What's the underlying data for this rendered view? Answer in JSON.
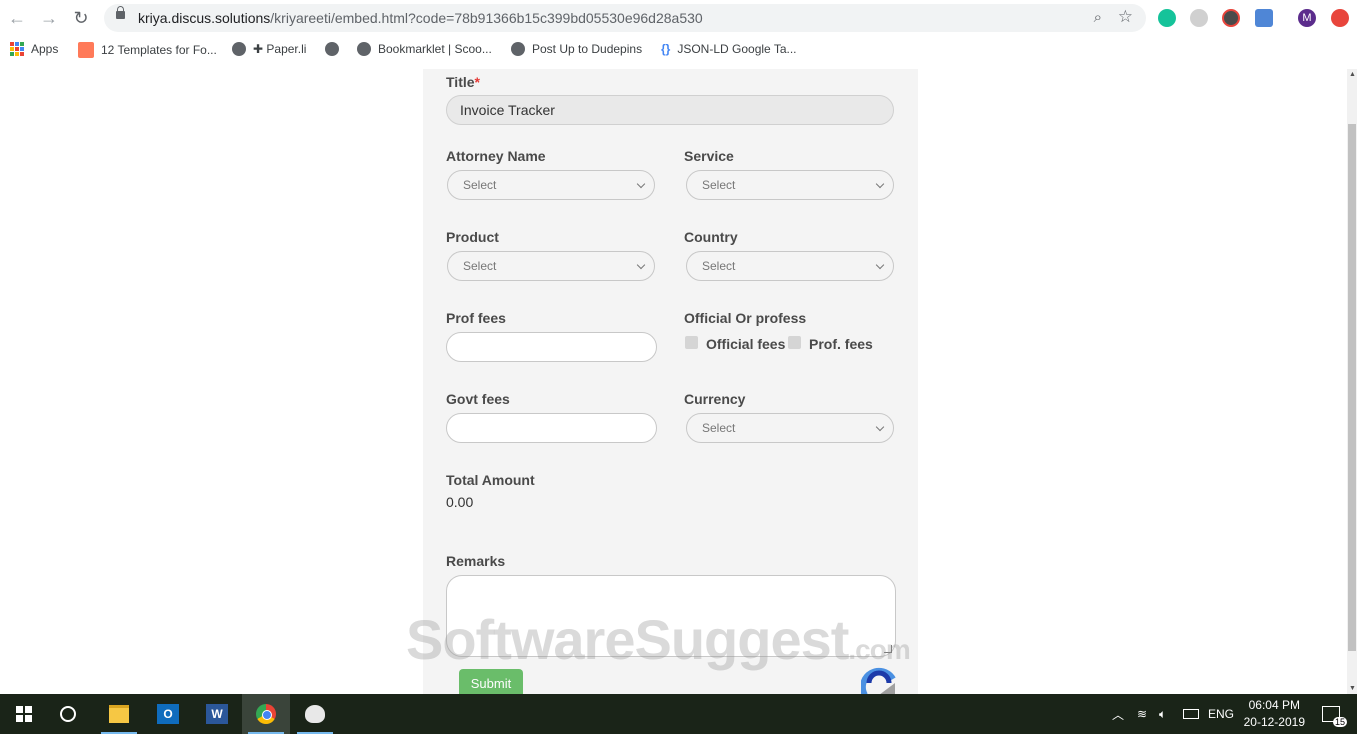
{
  "browser": {
    "url_host": "kriya.discus.solutions",
    "url_path": "/kriyareeti/embed.html?code=78b91366b15c399bd05530e96d28a530",
    "profile_initial": "M",
    "bookmarks": [
      {
        "label": "Apps"
      },
      {
        "label": "12 Templates for Fo..."
      },
      {
        "label": "✚ Paper.li"
      },
      {
        "label": ""
      },
      {
        "label": "Bookmarklet | Scoo..."
      },
      {
        "label": "Post Up to Dudepins"
      },
      {
        "label": "JSON-LD Google Ta..."
      }
    ]
  },
  "form": {
    "title_label": "Title",
    "title_required": "*",
    "title_value": "Invoice Tracker",
    "attorney_label": "Attorney Name",
    "attorney_value": "Select",
    "service_label": "Service",
    "service_value": "Select",
    "product_label": "Product",
    "product_value": "Select",
    "country_label": "Country",
    "country_value": "Select",
    "prof_fees_label": "Prof fees",
    "official_label": "Official Or profess",
    "official_option1": "Official fees",
    "official_option2": "Prof. fees",
    "govt_fees_label": "Govt fees",
    "currency_label": "Currency",
    "currency_value": "Select",
    "total_label": "Total Amount",
    "total_value": "0.00",
    "remarks_label": "Remarks",
    "submit_label": "Submit"
  },
  "watermark": {
    "main": "SoftwareSuggest",
    "suffix": ".com"
  },
  "taskbar": {
    "lang": "ENG",
    "time": "06:04 PM",
    "date": "20-12-2019",
    "notifications": "15"
  },
  "colors": {
    "submit": "#5cb85c",
    "required": "#e53935",
    "card": "#f4f4f4"
  }
}
